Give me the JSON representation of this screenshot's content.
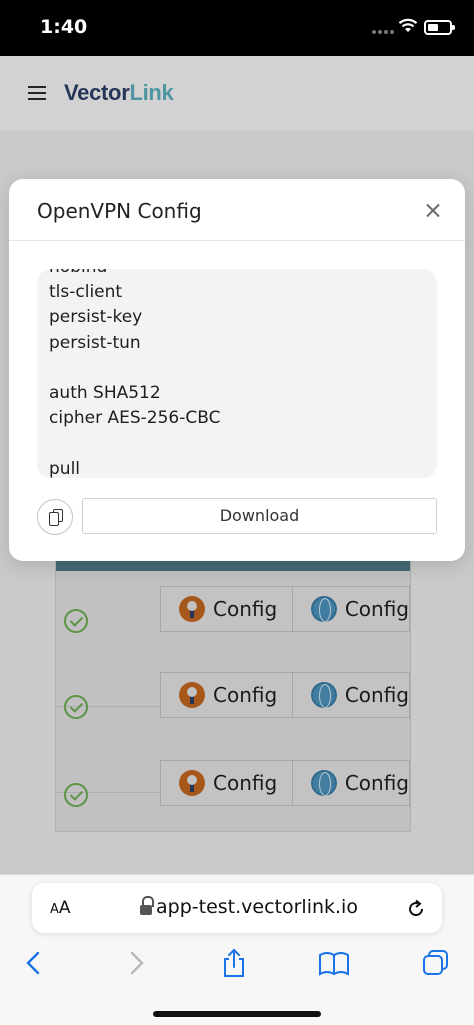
{
  "status": {
    "time": "1:40"
  },
  "header": {
    "logo_part1": "Vector",
    "logo_part2": "Link"
  },
  "modal": {
    "title": "OpenVPN Config",
    "config_text": "nobind\ntls-client\npersist-key\npersist-tun\n\nauth SHA512\ncipher AES-256-CBC\n\npull",
    "download_label": "Download"
  },
  "rows": [
    {
      "config_openvpn": "Config",
      "config_wireguard": "Config"
    },
    {
      "config_openvpn": "Config",
      "config_wireguard": "Config"
    },
    {
      "config_openvpn": "Config",
      "config_wireguard": "Config"
    }
  ],
  "browser": {
    "aa_large": "A",
    "aa_small": "A",
    "url": "app-test.vectorlink.io"
  },
  "colors": {
    "brand": "#2c3e66",
    "brand_accent": "#5aa9b8",
    "table_header": "#4f7a86",
    "ios_blue": "#1a73e8",
    "check_green": "#6aa84f"
  },
  "icons": [
    "hamburger-icon",
    "close-icon",
    "copy-icon",
    "check-icon",
    "openvpn-icon",
    "globe-icon",
    "lock-icon",
    "reload-icon",
    "back-icon",
    "forward-icon",
    "share-icon",
    "bookmarks-icon",
    "tabs-icon",
    "wifi-icon",
    "battery-icon"
  ]
}
